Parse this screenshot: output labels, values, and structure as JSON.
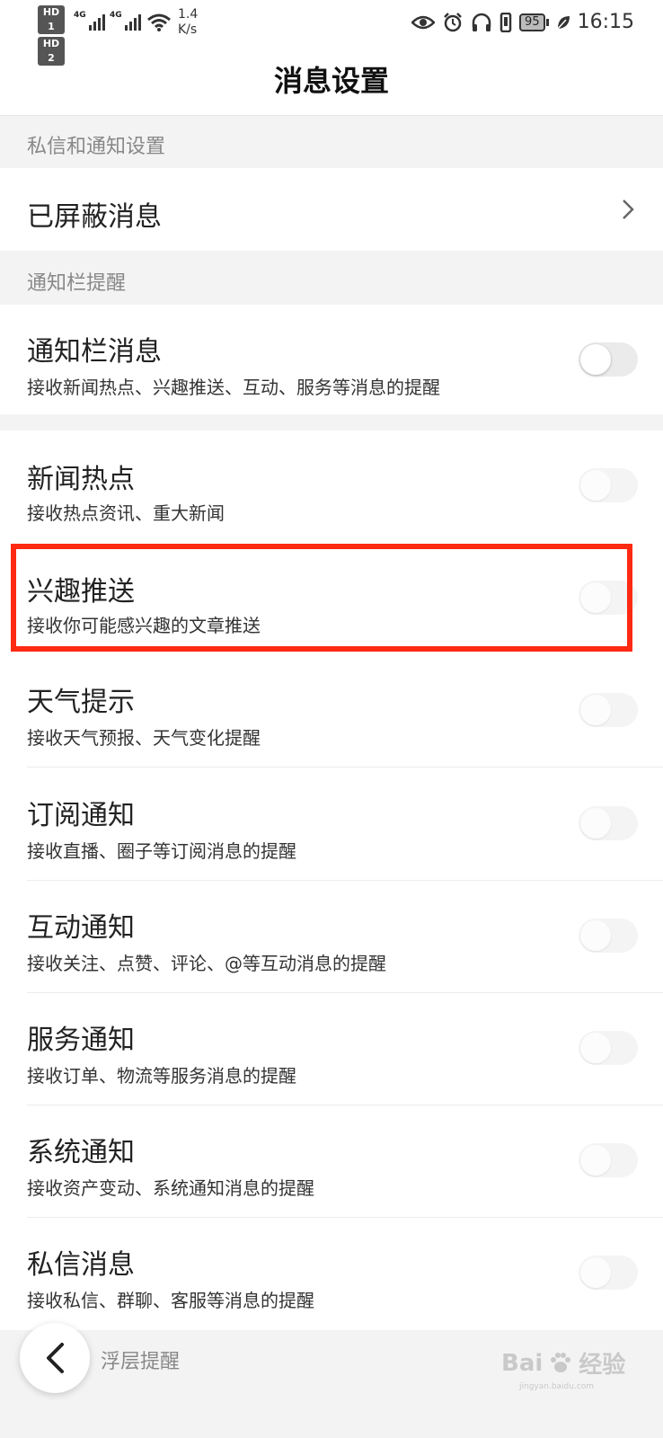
{
  "status_bar": {
    "hd1": "HD 1",
    "hd2": "HD 2",
    "net1": "4G",
    "net2": "4G",
    "speed_value": "1.4",
    "speed_unit": "K/s",
    "battery": "95",
    "time": "16:15",
    "icons": [
      "eye-icon",
      "alarm-icon",
      "headphones-icon",
      "vibrate-icon",
      "battery-icon",
      "leaf-icon"
    ]
  },
  "header": {
    "title": "消息设置"
  },
  "sections": {
    "private": "私信和通知设置",
    "notify_bar": "通知栏提醒",
    "float": "浮层提醒"
  },
  "blocked": {
    "title": "已屏蔽消息"
  },
  "settings": [
    {
      "title": "通知栏消息",
      "desc": "接收新闻热点、兴趣推送、互动、服务等消息的提醒",
      "enabled": false
    },
    {
      "title": "新闻热点",
      "desc": "接收热点资讯、重大新闻",
      "enabled": false
    },
    {
      "title": "兴趣推送",
      "desc": "接收你可能感兴趣的文章推送",
      "enabled": false
    },
    {
      "title": "天气提示",
      "desc": "接收天气预报、天气变化提醒",
      "enabled": false
    },
    {
      "title": "订阅通知",
      "desc": "接收直播、圈子等订阅消息的提醒",
      "enabled": false
    },
    {
      "title": "互动通知",
      "desc": "接收关注、点赞、评论、@等互动消息的提醒",
      "enabled": false
    },
    {
      "title": "服务通知",
      "desc": "接收订单、物流等服务消息的提醒",
      "enabled": false
    },
    {
      "title": "系统通知",
      "desc": "接收资产变动、系统通知消息的提醒",
      "enabled": false
    },
    {
      "title": "私信消息",
      "desc": "接收私信、群聊、客服等消息的提醒",
      "enabled": false
    }
  ],
  "highlight_color": "#ff2a12",
  "watermark": {
    "brand": "Bai",
    "suffix": "经验",
    "url": "jingyan.baidu.com"
  }
}
